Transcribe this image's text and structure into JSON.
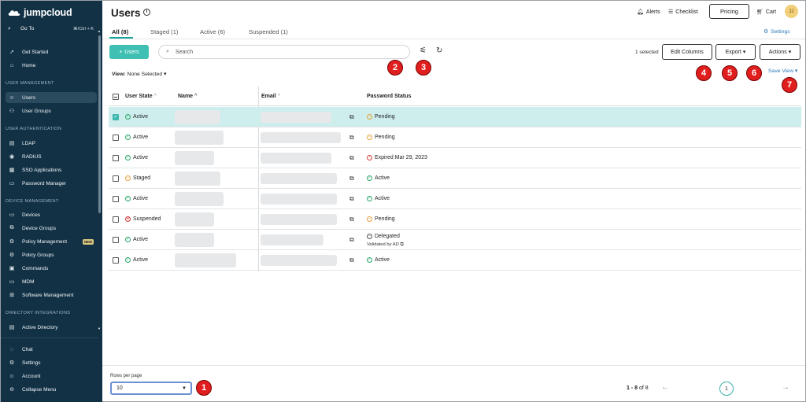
{
  "sidebar": {
    "logo": "jumpcloud",
    "goto": {
      "label": "Go To",
      "shortcut": "⌘/Ctrl + K"
    },
    "items": [
      {
        "label": "Get Started",
        "icon": "rocket-icon"
      },
      {
        "label": "Home",
        "icon": "home-icon"
      }
    ],
    "sections": [
      {
        "title": "USER MANAGEMENT",
        "items": [
          {
            "label": "Users",
            "icon": "user-icon"
          },
          {
            "label": "User Groups",
            "icon": "user-group-icon"
          }
        ]
      },
      {
        "title": "USER AUTHENTICATION",
        "items": [
          {
            "label": "LDAP",
            "icon": "ldap-icon"
          },
          {
            "label": "RADIUS",
            "icon": "radius-icon"
          },
          {
            "label": "SSO Applications",
            "icon": "grid-icon"
          },
          {
            "label": "Password Manager",
            "icon": "password-icon"
          }
        ]
      },
      {
        "title": "DEVICE MANAGEMENT",
        "items": [
          {
            "label": "Devices",
            "icon": "laptop-icon"
          },
          {
            "label": "Device Groups",
            "icon": "device-group-icon"
          },
          {
            "label": "Policy Management",
            "icon": "policy-icon",
            "badge": "NEW"
          },
          {
            "label": "Policy Groups",
            "icon": "policy-group-icon"
          },
          {
            "label": "Commands",
            "icon": "terminal-icon"
          },
          {
            "label": "MDM",
            "icon": "mdm-icon"
          },
          {
            "label": "Software Management",
            "icon": "software-icon"
          }
        ]
      },
      {
        "title": "DIRECTORY INTEGRATIONS",
        "items": [
          {
            "label": "Active Directory",
            "icon": "directory-icon"
          }
        ]
      }
    ],
    "bottom_items": [
      {
        "label": "Chat",
        "icon": "chat-icon"
      },
      {
        "label": "Settings",
        "icon": "gear-icon"
      },
      {
        "label": "Account",
        "icon": "account-icon"
      },
      {
        "label": "Collapse Menu",
        "icon": "collapse-icon"
      }
    ]
  },
  "header": {
    "title": "Users",
    "alerts": "Alerts",
    "checklist": "Checklist",
    "pricing": "Pricing",
    "cart": "Cart",
    "avatar": "JJ"
  },
  "tabs": [
    {
      "label": "All (8)",
      "active": true
    },
    {
      "label": "Staged (1)",
      "active": false
    },
    {
      "label": "Active (6)",
      "active": false
    },
    {
      "label": "Suspended (1)",
      "active": false
    }
  ],
  "settings_link": "Settings",
  "toolbar": {
    "add_label": "Users",
    "search_placeholder": "Search",
    "selected": "1 selected",
    "edit_columns": "Edit Columns",
    "export": "Export",
    "actions": "Actions",
    "view_label": "View:",
    "view_value": "None Selected",
    "save_view": "Save View"
  },
  "badges": [
    "1",
    "2",
    "3",
    "4",
    "5",
    "6",
    "7"
  ],
  "table": {
    "headers": {
      "state": "User State",
      "name": "Name",
      "email": "Email",
      "password": "Password Status"
    },
    "rows": [
      {
        "state": "Active",
        "state_kind": "active",
        "password": "Pending",
        "pw_kind": "pending",
        "selected": true
      },
      {
        "state": "Active",
        "state_kind": "active",
        "password": "Pending",
        "pw_kind": "pending",
        "selected": false
      },
      {
        "state": "Active",
        "state_kind": "active",
        "password": "Expired Mar 29, 2023",
        "pw_kind": "expired",
        "selected": false
      },
      {
        "state": "Staged",
        "state_kind": "staged",
        "password": "Active",
        "pw_kind": "active",
        "selected": false
      },
      {
        "state": "Active",
        "state_kind": "active",
        "password": "Active",
        "pw_kind": "active",
        "selected": false
      },
      {
        "state": "Suspended",
        "state_kind": "suspended",
        "password": "Pending",
        "pw_kind": "pending",
        "selected": false
      },
      {
        "state": "Active",
        "state_kind": "active",
        "password": "Delegated",
        "pw_kind": "delegated",
        "sub": "Validated by AD",
        "selected": false
      },
      {
        "state": "Active",
        "state_kind": "active",
        "password": "Active",
        "pw_kind": "active",
        "selected": false
      }
    ]
  },
  "footer": {
    "rows_per_page_label": "Rows per page",
    "rows_per_page_value": "10",
    "range": "1 - 8",
    "of": "of 8",
    "page": "1"
  },
  "colors": {
    "sidebar_bg": "#123145",
    "accent": "#3fc0b3",
    "badge_red": "#e01e1e",
    "link_blue": "#2c7ab8",
    "selected_row": "#cdeeed"
  }
}
